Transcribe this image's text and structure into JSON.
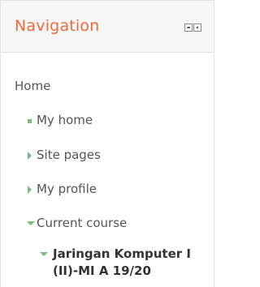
{
  "navigation": {
    "title": "Navigation",
    "controls": {
      "minimize_icon": "minimize-icon",
      "dock_icon": "dock-icon"
    },
    "items": [
      {
        "label": "Home",
        "icon": "none"
      },
      {
        "label": "My home",
        "icon": "bullet-icon"
      },
      {
        "label": "Site pages",
        "icon": "expand-arrow-right-icon"
      },
      {
        "label": "My profile",
        "icon": "expand-arrow-right-icon"
      },
      {
        "label": "Current course",
        "icon": "collapse-arrow-down-icon"
      }
    ],
    "current_course": {
      "label_line1": "Jaringan Komputer I",
      "label_line2": "(II)-MI A 19/20",
      "icon": "collapse-arrow-down-icon"
    }
  },
  "colors": {
    "title": "#ef6a3a",
    "text": "#555555",
    "course_text": "#333333",
    "accent_green": "#7cbb7c",
    "header_bg": "#f7f7f7",
    "border": "#e3e3e3"
  }
}
